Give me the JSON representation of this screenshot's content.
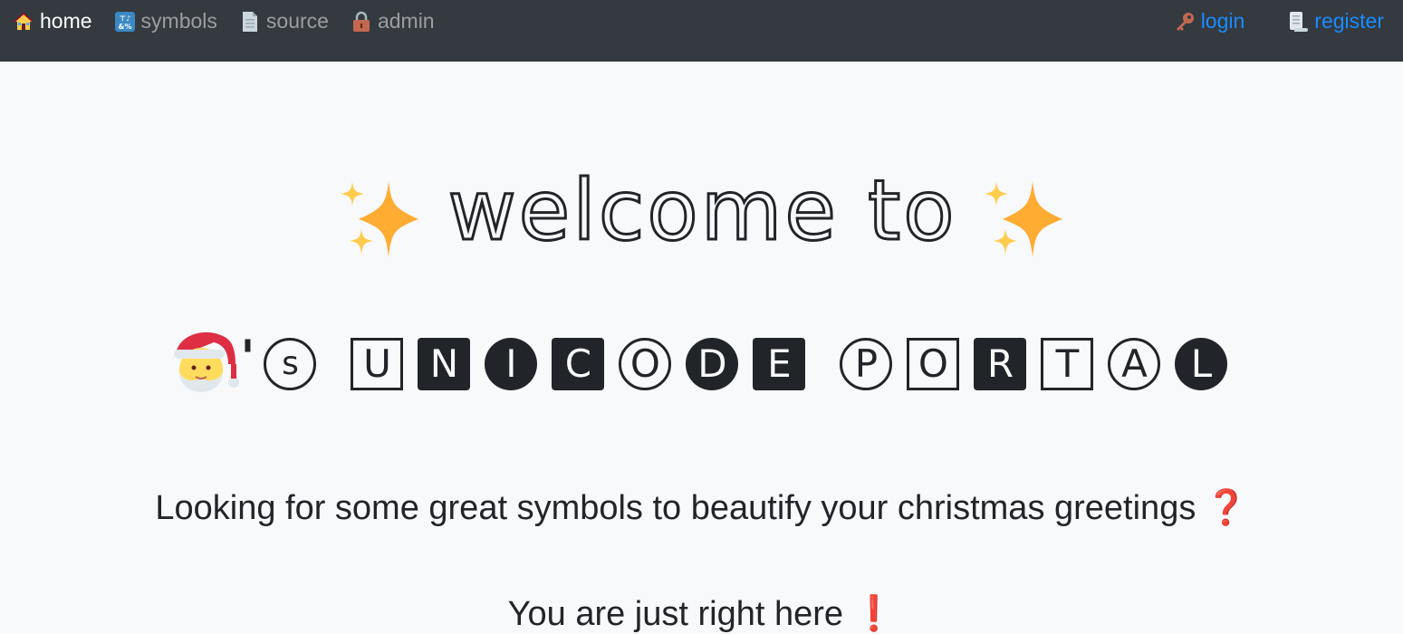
{
  "nav": {
    "left": [
      {
        "label": "home",
        "icon": "house-icon",
        "active": true
      },
      {
        "label": "symbols",
        "icon": "symbols-icon"
      },
      {
        "label": "source",
        "icon": "page-icon"
      },
      {
        "label": "admin",
        "icon": "lock-icon"
      }
    ],
    "right": [
      {
        "label": "login",
        "icon": "key-icon"
      },
      {
        "label": "register",
        "icon": "scroll-icon"
      }
    ]
  },
  "hero": {
    "welcome": "welcome to",
    "possessive": "'",
    "title_letters": [
      "s",
      "U",
      "N",
      "I",
      "C",
      "O",
      "D",
      "E",
      "P",
      "O",
      "R",
      "T",
      "A",
      "L"
    ]
  },
  "tagline": "Looking for some great symbols to beautify your christmas greetings",
  "tagline_mark": "❓",
  "answer": "You are just right here",
  "answer_mark": "❗",
  "colors": {
    "navbar": "#343a40",
    "link": "#1a8cff",
    "sparkle": "#ffac33",
    "mark_red": "#be1931"
  }
}
